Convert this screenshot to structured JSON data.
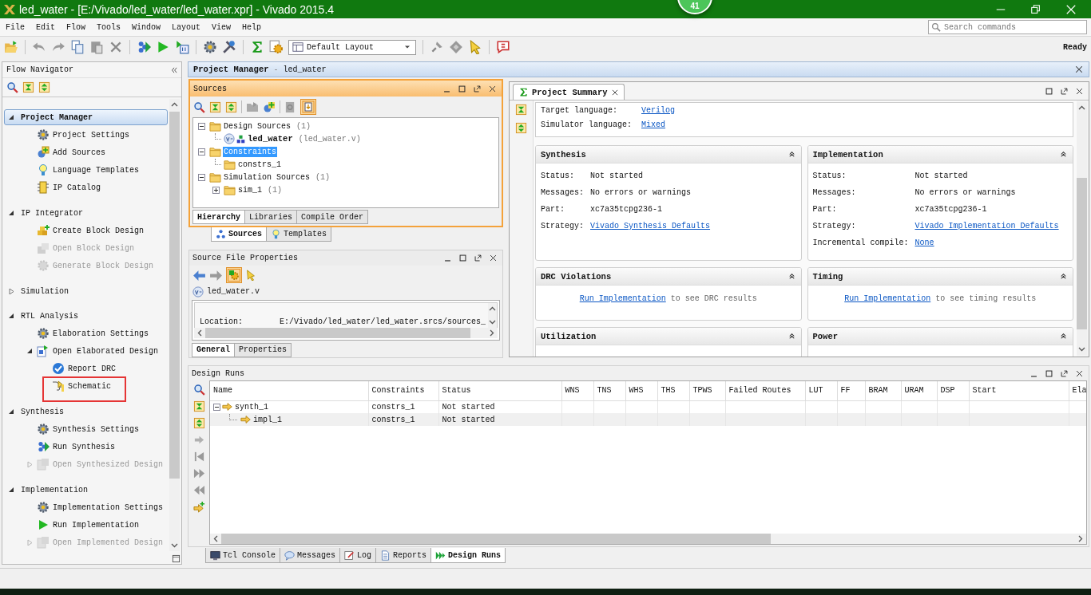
{
  "window": {
    "title": "led_water - [E:/Vivado/led_water/led_water.xpr] - Vivado 2015.4"
  },
  "notification_badge": "41",
  "menu": [
    "File",
    "Edit",
    "Flow",
    "Tools",
    "Window",
    "Layout",
    "View",
    "Help"
  ],
  "search": {
    "placeholder": "Search commands"
  },
  "toolbar": {
    "layout": "Default Layout",
    "status": "Ready"
  },
  "flow_navigator": {
    "title": "Flow Navigator",
    "sections": [
      {
        "label": "Project Manager",
        "expanded": true,
        "selected": true,
        "items": [
          {
            "label": "Project Settings",
            "disabled": false,
            "highlighted": false
          },
          {
            "label": "Add Sources",
            "disabled": false,
            "highlighted": false
          },
          {
            "label": "Language Templates",
            "disabled": false,
            "highlighted": false
          },
          {
            "label": "IP Catalog",
            "disabled": false,
            "highlighted": false
          }
        ]
      },
      {
        "label": "IP Integrator",
        "expanded": true,
        "selected": false,
        "items": [
          {
            "label": "Create Block Design",
            "disabled": false,
            "highlighted": false
          },
          {
            "label": "Open Block Design",
            "disabled": true,
            "highlighted": false
          },
          {
            "label": "Generate Block Design",
            "disabled": true,
            "highlighted": false
          }
        ]
      },
      {
        "label": "Simulation",
        "expanded": false,
        "selected": false
      },
      {
        "label": "RTL Analysis",
        "expanded": true,
        "selected": false,
        "items": [
          {
            "label": "Elaboration Settings",
            "disabled": false,
            "highlighted": false
          },
          {
            "label": "Open Elaborated Design",
            "disabled": false,
            "highlighted": false,
            "expanded": true,
            "children": [
              {
                "label": "Report DRC",
                "disabled": false,
                "highlighted": false
              },
              {
                "label": "Schematic",
                "disabled": false,
                "highlighted": true
              }
            ]
          }
        ]
      },
      {
        "label": "Synthesis",
        "expanded": true,
        "selected": false,
        "items": [
          {
            "label": "Synthesis Settings",
            "disabled": false,
            "highlighted": false
          },
          {
            "label": "Run Synthesis",
            "disabled": false,
            "highlighted": false
          },
          {
            "label": "Open Synthesized Design",
            "disabled": true,
            "highlighted": false,
            "expanded": false
          }
        ]
      },
      {
        "label": "Implementation",
        "expanded": true,
        "selected": false,
        "items": [
          {
            "label": "Implementation Settings",
            "disabled": false,
            "highlighted": false
          },
          {
            "label": "Run Implementation",
            "disabled": false,
            "highlighted": false
          },
          {
            "label": "Open Implemented Design",
            "disabled": true,
            "highlighted": false,
            "expanded": false
          }
        ]
      }
    ]
  },
  "project_manager": {
    "title": "Project Manager",
    "separator": "-",
    "project": "led_water"
  },
  "sources": {
    "title": "Sources",
    "tree": [
      {
        "label": "Design Sources",
        "count": "(1)",
        "expanded": true,
        "selected": false,
        "children": [
          {
            "label": "led_water",
            "file": "(led_water.v)",
            "selected": false
          }
        ]
      },
      {
        "label": "Constraints",
        "expanded": true,
        "selected": true,
        "children": [
          {
            "label": "constrs_1",
            "selected": false
          }
        ]
      },
      {
        "label": "Simulation Sources",
        "count": "(1)",
        "expanded": true,
        "selected": false,
        "children": [
          {
            "label": "sim_1",
            "count": "(1)",
            "expanded": false,
            "selected": false
          }
        ]
      }
    ],
    "view_tabs": [
      {
        "label": "Hierarchy",
        "selected": true
      },
      {
        "label": "Libraries",
        "selected": false
      },
      {
        "label": "Compile Order",
        "selected": false
      }
    ],
    "panel_tabs": [
      {
        "label": "Sources",
        "selected": true
      },
      {
        "label": "Templates",
        "selected": false
      }
    ]
  },
  "source_file_properties": {
    "title": "Source File Properties",
    "file": "led_water.v",
    "location_label": "Location:",
    "location": "E:/Vivado/led_water/led_water.srcs/sources_",
    "tabs": [
      {
        "label": "General",
        "selected": true
      },
      {
        "label": "Properties",
        "selected": false
      }
    ]
  },
  "project_summary": {
    "tab": "Project Summary",
    "settings": [
      {
        "label": "Target language:",
        "value": "Verilog"
      },
      {
        "label": "Simulator language:",
        "value": "Mixed"
      }
    ],
    "cards": [
      {
        "title": "Synthesis",
        "kind": "fields",
        "fields": [
          {
            "label": "Status:",
            "value": "Not started",
            "kind": "text"
          },
          {
            "label": "Messages:",
            "value": "No errors or warnings",
            "kind": "text"
          },
          {
            "label": "Part:",
            "value": "xc7a35tcpg236-1",
            "kind": "text"
          },
          {
            "label": "Strategy:",
            "value": "Vivado Synthesis Defaults",
            "kind": "link"
          }
        ]
      },
      {
        "title": "Implementation",
        "kind": "fields",
        "fields": [
          {
            "label": "Status:",
            "value": "Not started",
            "kind": "text"
          },
          {
            "label": "Messages:",
            "value": "No errors or warnings",
            "kind": "text"
          },
          {
            "label": "Part:",
            "value": "xc7a35tcpg236-1",
            "kind": "text"
          },
          {
            "label": "Strategy:",
            "value": "Vivado Implementation Defaults",
            "kind": "link"
          },
          {
            "label": "Incremental compile:",
            "value": "None",
            "kind": "link"
          }
        ]
      },
      {
        "title": "DRC Violations",
        "kind": "message",
        "link": "Run Implementation",
        "text": "to see DRC results"
      },
      {
        "title": "Timing",
        "kind": "message",
        "link": "Run Implementation",
        "text": "to see timing results"
      },
      {
        "title": "Utilization",
        "kind": "empty"
      },
      {
        "title": "Power",
        "kind": "empty"
      }
    ]
  },
  "design_runs": {
    "title": "Design Runs",
    "columns": [
      "Name",
      "Constraints",
      "Status",
      "WNS",
      "TNS",
      "WHS",
      "THS",
      "TPWS",
      "Failed Routes",
      "LUT",
      "FF",
      "BRAM",
      "URAM",
      "DSP",
      "Start",
      "Ela"
    ],
    "rows": [
      {
        "cells": [
          "synth_1",
          "constrs_1",
          "Not started"
        ],
        "expanded": true,
        "children": [
          {
            "cells": [
              "impl_1",
              "constrs_1",
              "Not started"
            ]
          }
        ]
      }
    ]
  },
  "bottom_tabs": [
    {
      "label": "Tcl Console",
      "selected": false
    },
    {
      "label": "Messages",
      "selected": false
    },
    {
      "label": "Log",
      "selected": false
    },
    {
      "label": "Reports",
      "selected": false
    },
    {
      "label": "Design Runs",
      "selected": true
    }
  ]
}
